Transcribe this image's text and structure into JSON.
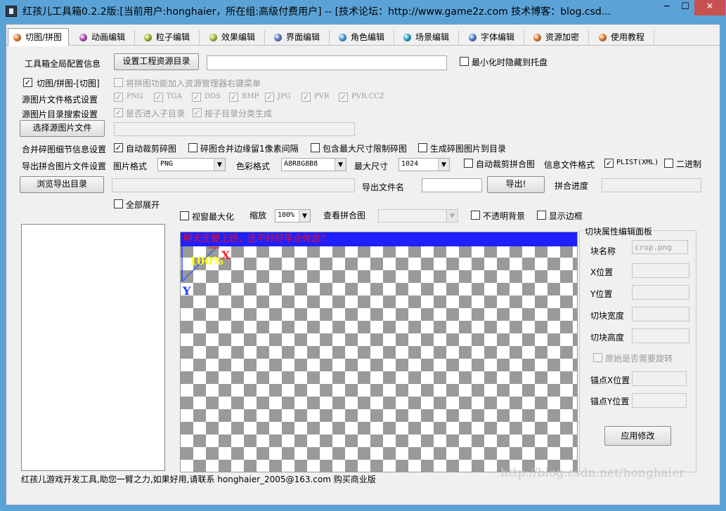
{
  "window": {
    "title": "红孩儿工具箱0.2.2版:[当前用户:honghaier，所在组:高级付费用户]  --  [技术论坛：http://www.game2z.com 技术博客：blog.csd...",
    "minimize": "─",
    "maximize": "☐",
    "close": "✕"
  },
  "tabs": [
    {
      "label": "切图/拼图",
      "color": "#e07a2a"
    },
    {
      "label": "动画编辑",
      "color": "#b04ab8"
    },
    {
      "label": "粒子编辑",
      "color": "#9ab82a"
    },
    {
      "label": "效果编辑",
      "color": "#a8b830"
    },
    {
      "label": "界面编辑",
      "color": "#5a7ac8"
    },
    {
      "label": "角色编辑",
      "color": "#3a9ad8"
    },
    {
      "label": "场景编辑",
      "color": "#2aa0c8"
    },
    {
      "label": "字体编辑",
      "color": "#4a7ad0"
    },
    {
      "label": "资源加密",
      "color": "#e07a2a"
    },
    {
      "label": "使用教程",
      "color": "#e07a2a"
    }
  ],
  "config": {
    "global_label": "工具箱全局配置信息",
    "set_dir_button": "设置工程资源目录",
    "dir_value": "",
    "minimize_tray": "最小化时隐藏到托盘",
    "crop_mode": "切图/拼图-[切图]",
    "explorer_menu": "将拼图功能加入资源管理器右键菜单",
    "src_format_label": "源图片文件格式设置",
    "formats": [
      "PNG",
      "TGA",
      "DDS",
      "BMP",
      "JPG",
      "PVR",
      "PVR.CCZ"
    ],
    "src_search_label": "源图片目录搜索设置",
    "include_subdir": "是否进入子目录",
    "subdir_classify": "按子目录分类生成",
    "select_src_button": "选择源图片文件",
    "src_file_value": ""
  },
  "merge": {
    "detail_label": "合并碎图细节信息设置",
    "auto_crop": "自动裁剪碎图",
    "edge_pad": "碎图合并边缘留1像素间隔",
    "max_size_limit": "包含最大尺寸限制碎图",
    "gen_to_dir": "生成碎图图片到目录",
    "export_label": "导出拼合图片文件设置",
    "image_format_label": "图片格式",
    "image_format": "PNG",
    "color_format_label": "色彩格式",
    "color_format": "A8R8G8B8",
    "max_size_label": "最大尺寸",
    "max_size": "1024",
    "auto_crop_merged": "自动裁剪拼合图",
    "info_format_label": "信息文件格式",
    "plist": "PLIST(XML)",
    "binary": "二进制",
    "browse_export_button": "浏览导出目录",
    "export_dir_value": "",
    "export_name_label": "导出文件名",
    "export_name_value": "",
    "export_button": "导出!",
    "progress_label": "拼合进度"
  },
  "view": {
    "expand_all": "全部展开",
    "maximize_view": "视窗最大化",
    "zoom_label": "缩放",
    "zoom_value": "100%",
    "view_merged_label": "查看拼合图",
    "view_merged_value": "",
    "opaque_bg": "不透明背景",
    "show_border": "显示边框",
    "banner": "明天还要上班，还不好好早点休息？",
    "zoom_overlay": "100%",
    "axis_x": "X",
    "axis_y": "Y"
  },
  "panel": {
    "title": "切块属性编辑面板",
    "name_label": "块名称",
    "name_value": "crop.png",
    "x_label": "X位置",
    "y_label": "Y位置",
    "w_label": "切块宽度",
    "h_label": "切块高度",
    "rotate_label": "原始是否需要旋转",
    "anchor_x_label": "锚点X位置",
    "anchor_y_label": "锚点Y位置",
    "apply_button": "应用修改"
  },
  "status": {
    "text": "红孩儿游戏开发工具,助您一臂之力,如果好用,请联系 honghaier_2005@163.com 购买商业版",
    "watermark": "http://blog.csdn.net/honghaier"
  }
}
